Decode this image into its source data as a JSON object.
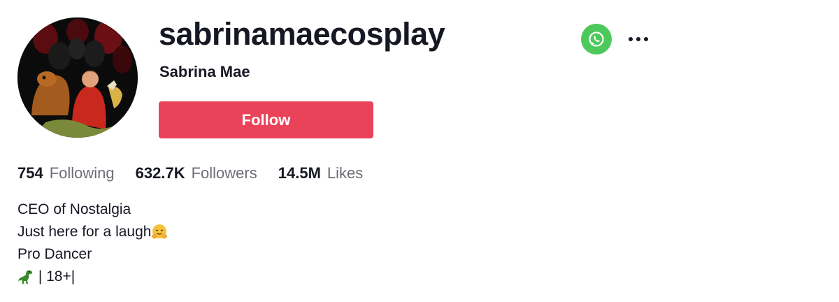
{
  "profile": {
    "username": "sabrinamaecosplay",
    "nickname": "Sabrina Mae",
    "follow_label": "Follow"
  },
  "stats": {
    "following": {
      "value": "754",
      "label": "Following"
    },
    "followers": {
      "value": "632.7K",
      "label": "Followers"
    },
    "likes": {
      "value": "14.5M",
      "label": "Likes"
    }
  },
  "bio": {
    "line1": "CEO of Nostalgia",
    "line2": "Just here for a laugh",
    "line3": "Pro Dancer",
    "line4": " | 18+|"
  },
  "icons": {
    "share": "whatsapp-icon",
    "more": "more-options-icon",
    "hug_emoji": "hugging-face-emoji",
    "dino_emoji": "t-rex-emoji"
  },
  "colors": {
    "follow_button": "#ea4359",
    "whatsapp": "#4dc95c",
    "secondary_text": "#6d6e75",
    "primary_text": "#161823"
  }
}
